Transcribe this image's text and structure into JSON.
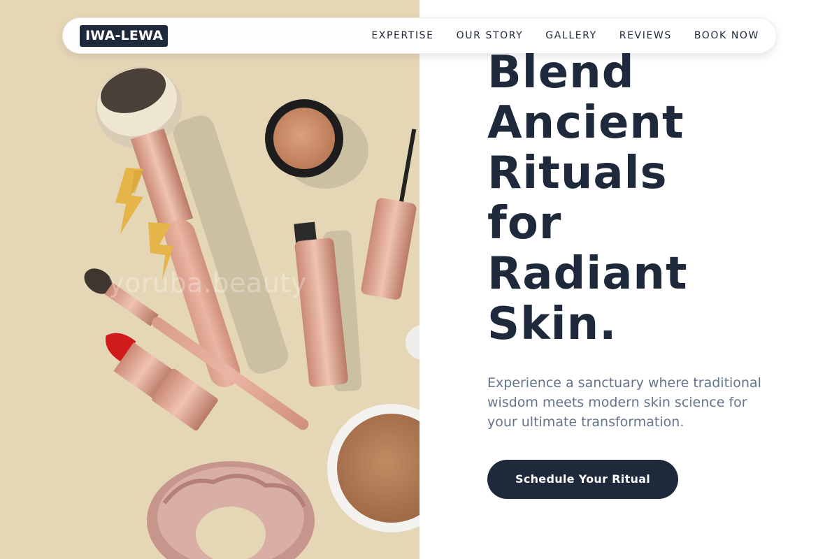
{
  "brand": {
    "logo_text": "IWA-LEWA"
  },
  "nav": {
    "links": [
      {
        "label": "EXPERTISE"
      },
      {
        "label": "OUR STORY"
      },
      {
        "label": "GALLERY"
      },
      {
        "label": "REVIEWS"
      },
      {
        "label": "BOOK NOW"
      }
    ]
  },
  "hero": {
    "headline_lines": [
      "Blend",
      "Ancient",
      "Rituals",
      "for",
      "Radiant",
      "Skin."
    ],
    "subtext": "Experience a sanctuary where traditional wisdom meets modern skin science for your ultimate transformation.",
    "cta_label": "Schedule Your Ritual",
    "image_watermark": "yoruba.beauty"
  },
  "colors": {
    "primary": "#1e293b",
    "muted_text": "#64748b",
    "image_background": "#e5d7b6",
    "accent_rose": "#d9a08e"
  }
}
